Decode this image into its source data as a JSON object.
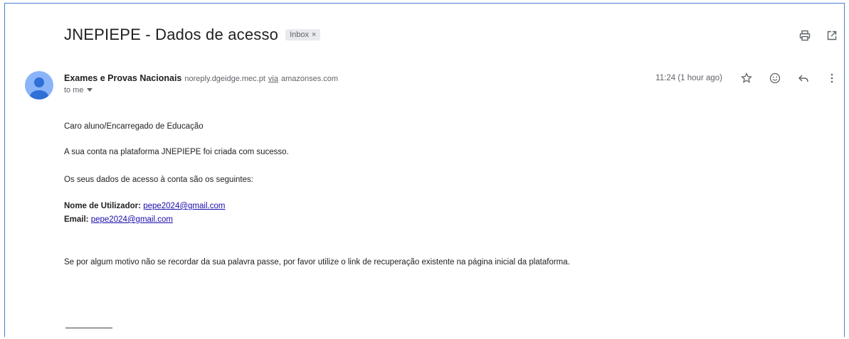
{
  "email": {
    "subject": "JNEPIEPE - Dados de acesso",
    "label": "Inbox",
    "sender_name": "Exames e Provas Nacionais",
    "sender_email": "noreply.dgeidge.mec.pt",
    "via_word": "via",
    "via_domain": "amazonses.com",
    "recipient_line": "to me",
    "timestamp": "11:24 (1 hour ago)",
    "body": {
      "greeting": "Caro aluno/Encarregado de Educação",
      "line1": "A sua conta na plataforma JNEPIEPE foi criada com sucesso.",
      "line2": "Os seus dados de acesso à conta são os seguintes:",
      "username_label": "Nome de Utilizador:",
      "username_value": "pepe2024@gmail.com",
      "email_label": "Email:",
      "email_value": "pepe2024@gmail.com",
      "recovery_note": "Se por algum motivo não se recordar da sua palavra passe, por favor utilize o link de recuperação existente na página inicial da plataforma."
    }
  },
  "icons": {
    "print": "print-icon",
    "open_new": "open-in-new-window-icon",
    "star": "star-icon",
    "emoji": "emoji-react-icon",
    "reply": "reply-icon",
    "more": "more-vertical-icon",
    "dropdown": "chevron-down-icon",
    "label_close": "close-icon"
  },
  "colors": {
    "border_accent": "#4a7fd4",
    "avatar_bg": "#8ab4f8",
    "link": "#1a0dab"
  }
}
